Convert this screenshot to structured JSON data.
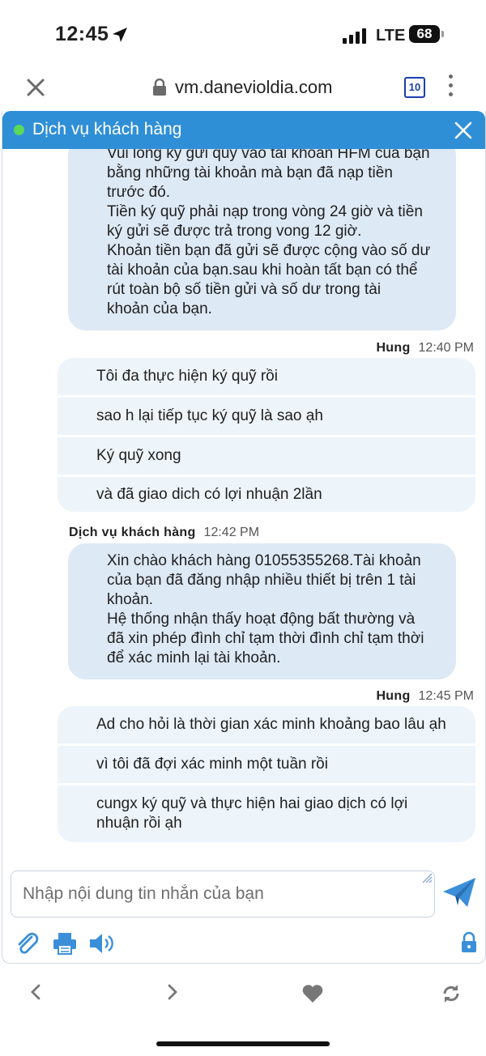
{
  "status_bar": {
    "time": "12:45",
    "network": "LTE",
    "battery": "68"
  },
  "browser": {
    "url": "vm.danevioldia.com",
    "tabs_count": "10"
  },
  "chat": {
    "header_title": "Dịch vụ khách hàng",
    "agent_message_1": "Vui lòng ký gửi quỹ vào tài khoản HFM của bạn\nbằng những tài khoản mà bạn đã nạp tiền\ntrước đó.\nTiền ký quỹ phải nạp trong vòng 24 giờ và tiền\nký gửi sẽ được trả trong vong 12 giờ.\nKhoản tiền bạn đã gửi sẽ được cộng vào số dư\ntài khoản của bạn.sau khi hoàn tất bạn có thể\nrút toàn bộ số tiền gửi và số dư trong tài\nkhoản của bạn.",
    "user_group_1": {
      "sender": "Hung",
      "time": "12:40 PM",
      "messages": [
        "Tôi đa thực hiện ký quỹ rồi",
        "sao h lại tiếp tục ký quỹ là sao ạh",
        "Ký quỹ xong",
        "và đã giao dich có lợi nhuận 2lần"
      ]
    },
    "agent_group_2": {
      "sender": "Dịch vụ khách hàng",
      "time": "12:42 PM",
      "message": "Xin chào khách hàng 01055355268.Tài khoản\ncủa bạn đã đăng nhập nhiều thiết bị trên 1 tài\nkhoản.\nHệ thống nhận thấy hoạt động bất thường và\nđã xin phép đình chỉ tạm thời đình chỉ tạm thời\nđể xác minh lại tài khoản."
    },
    "user_group_2": {
      "sender": "Hung",
      "time": "12:45 PM",
      "messages": [
        "Ad cho hỏi là thời gian xác minh khoảng bao lâu ạh",
        "vì tôi đã đợi xác minh một tuần rồi",
        "cungx ký quỹ và thực hiện hai giao dịch có lợi\nnhuận rồi ạh"
      ]
    },
    "input_placeholder": "Nhập nội dung tin nhắn của bạn"
  },
  "icons": {
    "header_status": "online-dot",
    "toolbar": [
      "paperclip-icon",
      "printer-icon",
      "speaker-icon",
      "lock-icon"
    ],
    "send": "send-plane-icon",
    "bottom_nav": [
      "back-icon",
      "forward-icon",
      "heart-icon",
      "refresh-icon"
    ]
  },
  "colors": {
    "header": "#2f8fd6",
    "agent_bubble": "#dde9f5",
    "user_bubble": "#edf4fa",
    "accent": "#3b8fd9"
  }
}
